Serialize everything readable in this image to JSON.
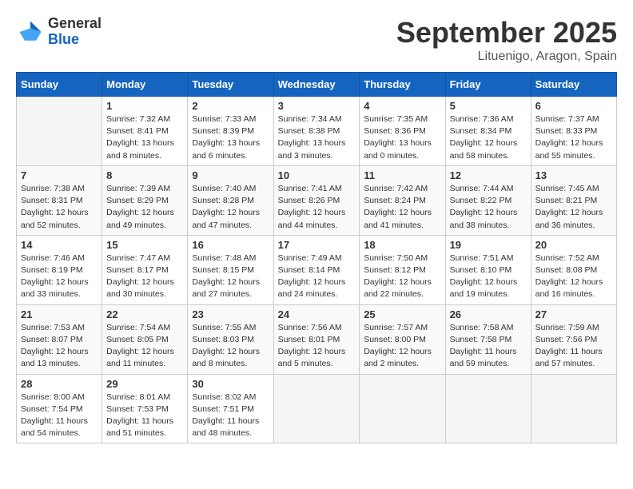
{
  "header": {
    "logo_general": "General",
    "logo_blue": "Blue",
    "month_title": "September 2025",
    "location": "Lituenigo, Aragon, Spain"
  },
  "days_of_week": [
    "Sunday",
    "Monday",
    "Tuesday",
    "Wednesday",
    "Thursday",
    "Friday",
    "Saturday"
  ],
  "weeks": [
    [
      {
        "day": "",
        "info": ""
      },
      {
        "day": "1",
        "info": "Sunrise: 7:32 AM\nSunset: 8:41 PM\nDaylight: 13 hours\nand 8 minutes."
      },
      {
        "day": "2",
        "info": "Sunrise: 7:33 AM\nSunset: 8:39 PM\nDaylight: 13 hours\nand 6 minutes."
      },
      {
        "day": "3",
        "info": "Sunrise: 7:34 AM\nSunset: 8:38 PM\nDaylight: 13 hours\nand 3 minutes."
      },
      {
        "day": "4",
        "info": "Sunrise: 7:35 AM\nSunset: 8:36 PM\nDaylight: 13 hours\nand 0 minutes."
      },
      {
        "day": "5",
        "info": "Sunrise: 7:36 AM\nSunset: 8:34 PM\nDaylight: 12 hours\nand 58 minutes."
      },
      {
        "day": "6",
        "info": "Sunrise: 7:37 AM\nSunset: 8:33 PM\nDaylight: 12 hours\nand 55 minutes."
      }
    ],
    [
      {
        "day": "7",
        "info": "Sunrise: 7:38 AM\nSunset: 8:31 PM\nDaylight: 12 hours\nand 52 minutes."
      },
      {
        "day": "8",
        "info": "Sunrise: 7:39 AM\nSunset: 8:29 PM\nDaylight: 12 hours\nand 49 minutes."
      },
      {
        "day": "9",
        "info": "Sunrise: 7:40 AM\nSunset: 8:28 PM\nDaylight: 12 hours\nand 47 minutes."
      },
      {
        "day": "10",
        "info": "Sunrise: 7:41 AM\nSunset: 8:26 PM\nDaylight: 12 hours\nand 44 minutes."
      },
      {
        "day": "11",
        "info": "Sunrise: 7:42 AM\nSunset: 8:24 PM\nDaylight: 12 hours\nand 41 minutes."
      },
      {
        "day": "12",
        "info": "Sunrise: 7:44 AM\nSunset: 8:22 PM\nDaylight: 12 hours\nand 38 minutes."
      },
      {
        "day": "13",
        "info": "Sunrise: 7:45 AM\nSunset: 8:21 PM\nDaylight: 12 hours\nand 36 minutes."
      }
    ],
    [
      {
        "day": "14",
        "info": "Sunrise: 7:46 AM\nSunset: 8:19 PM\nDaylight: 12 hours\nand 33 minutes."
      },
      {
        "day": "15",
        "info": "Sunrise: 7:47 AM\nSunset: 8:17 PM\nDaylight: 12 hours\nand 30 minutes."
      },
      {
        "day": "16",
        "info": "Sunrise: 7:48 AM\nSunset: 8:15 PM\nDaylight: 12 hours\nand 27 minutes."
      },
      {
        "day": "17",
        "info": "Sunrise: 7:49 AM\nSunset: 8:14 PM\nDaylight: 12 hours\nand 24 minutes."
      },
      {
        "day": "18",
        "info": "Sunrise: 7:50 AM\nSunset: 8:12 PM\nDaylight: 12 hours\nand 22 minutes."
      },
      {
        "day": "19",
        "info": "Sunrise: 7:51 AM\nSunset: 8:10 PM\nDaylight: 12 hours\nand 19 minutes."
      },
      {
        "day": "20",
        "info": "Sunrise: 7:52 AM\nSunset: 8:08 PM\nDaylight: 12 hours\nand 16 minutes."
      }
    ],
    [
      {
        "day": "21",
        "info": "Sunrise: 7:53 AM\nSunset: 8:07 PM\nDaylight: 12 hours\nand 13 minutes."
      },
      {
        "day": "22",
        "info": "Sunrise: 7:54 AM\nSunset: 8:05 PM\nDaylight: 12 hours\nand 11 minutes."
      },
      {
        "day": "23",
        "info": "Sunrise: 7:55 AM\nSunset: 8:03 PM\nDaylight: 12 hours\nand 8 minutes."
      },
      {
        "day": "24",
        "info": "Sunrise: 7:56 AM\nSunset: 8:01 PM\nDaylight: 12 hours\nand 5 minutes."
      },
      {
        "day": "25",
        "info": "Sunrise: 7:57 AM\nSunset: 8:00 PM\nDaylight: 12 hours\nand 2 minutes."
      },
      {
        "day": "26",
        "info": "Sunrise: 7:58 AM\nSunset: 7:58 PM\nDaylight: 11 hours\nand 59 minutes."
      },
      {
        "day": "27",
        "info": "Sunrise: 7:59 AM\nSunset: 7:56 PM\nDaylight: 11 hours\nand 57 minutes."
      }
    ],
    [
      {
        "day": "28",
        "info": "Sunrise: 8:00 AM\nSunset: 7:54 PM\nDaylight: 11 hours\nand 54 minutes."
      },
      {
        "day": "29",
        "info": "Sunrise: 8:01 AM\nSunset: 7:53 PM\nDaylight: 11 hours\nand 51 minutes."
      },
      {
        "day": "30",
        "info": "Sunrise: 8:02 AM\nSunset: 7:51 PM\nDaylight: 11 hours\nand 48 minutes."
      },
      {
        "day": "",
        "info": ""
      },
      {
        "day": "",
        "info": ""
      },
      {
        "day": "",
        "info": ""
      },
      {
        "day": "",
        "info": ""
      }
    ]
  ]
}
